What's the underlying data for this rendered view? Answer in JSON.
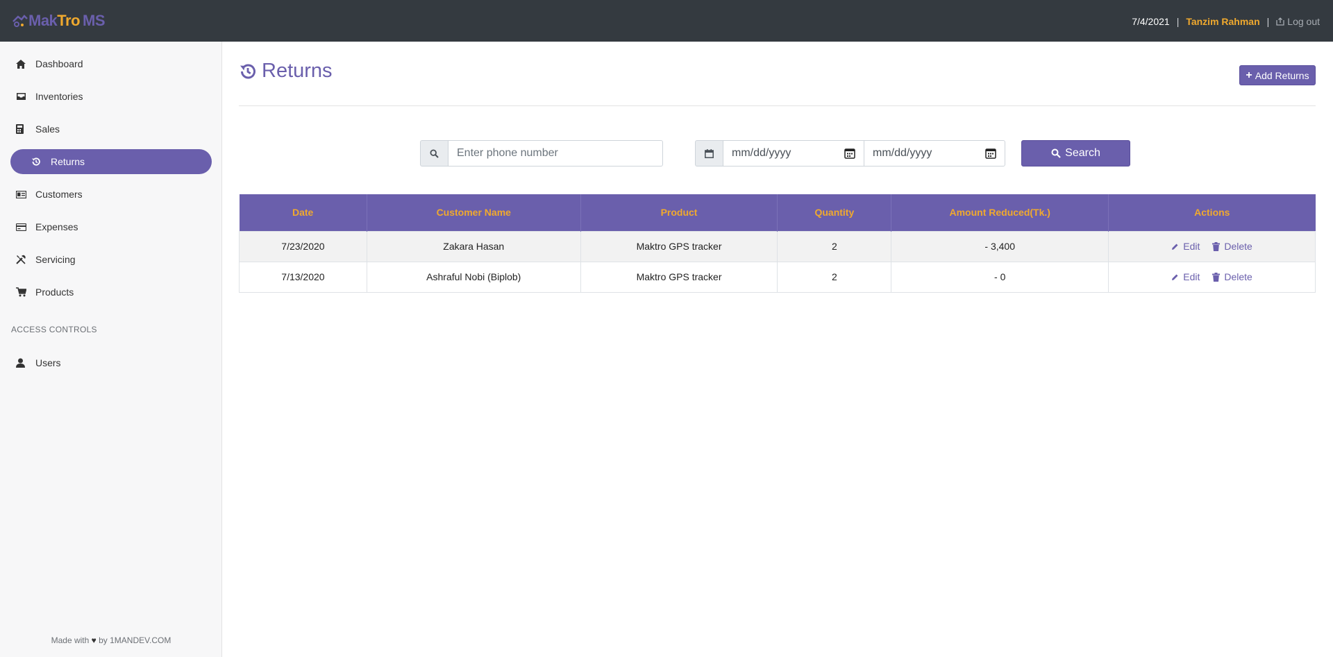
{
  "app": {
    "logo_part1": "Mak",
    "logo_part2": "Tro",
    "logo_part3": "MS",
    "date": "7/4/2021",
    "separator": "|",
    "user_name": "Tanzim Rahman",
    "logout_label": "Log out"
  },
  "sidebar": {
    "items": [
      {
        "label": "Dashboard",
        "icon": "home-icon"
      },
      {
        "label": "Inventories",
        "icon": "inbox-icon"
      },
      {
        "label": "Sales",
        "icon": "calculator-icon"
      },
      {
        "label": "Returns",
        "icon": "history-icon",
        "active": true
      },
      {
        "label": "Customers",
        "icon": "id-card-icon"
      },
      {
        "label": "Expenses",
        "icon": "credit-card-icon"
      },
      {
        "label": "Servicing",
        "icon": "tools-icon"
      },
      {
        "label": "Products",
        "icon": "cart-icon"
      }
    ],
    "section_title": "ACCESS CONTROLS",
    "access_items": [
      {
        "label": "Users",
        "icon": "user-icon"
      }
    ],
    "footer_prefix": "Made with",
    "footer_heart": "♥",
    "footer_suffix": "by 1MANDEV.COM"
  },
  "page": {
    "title": "Returns",
    "add_button": "Add Returns",
    "add_button_icon": "+"
  },
  "filters": {
    "phone_placeholder": "Enter phone number",
    "phone_value": "",
    "date_from_placeholder": "mm/dd/yyyy",
    "date_to_placeholder": "mm/dd/yyyy",
    "search_label": "Search"
  },
  "table": {
    "headers": [
      "Date",
      "Customer Name",
      "Product",
      "Quantity",
      "Amount Reduced(Tk.)",
      "Actions"
    ],
    "rows": [
      {
        "date": "7/23/2020",
        "customer": "Zakara Hasan",
        "product": "Maktro GPS tracker",
        "quantity": "2",
        "amount": "- 3,400"
      },
      {
        "date": "7/13/2020",
        "customer": "Ashraful Nobi (Biplob)",
        "product": "Maktro GPS tracker",
        "quantity": "2",
        "amount": "- 0"
      }
    ],
    "edit_label": "Edit",
    "delete_label": "Delete"
  },
  "colors": {
    "topbar": "#343a40",
    "accent": "#6a5fac",
    "brand_orange": "#f0a92e",
    "negative": "#dc3545"
  }
}
